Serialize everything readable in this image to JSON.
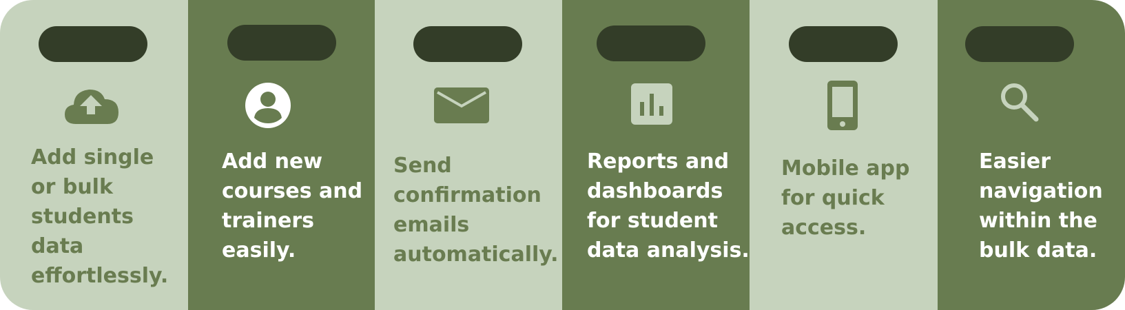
{
  "theme": {
    "light_panel": "#c6d3bd",
    "dark_panel": "#687c50",
    "pill": "#333d28",
    "light_text": "#697c50",
    "dark_text": "#ffffff"
  },
  "features": [
    {
      "icon": "cloud-upload-icon",
      "lines": [
        "Add single",
        "or bulk",
        "students",
        "data",
        "effortlessly."
      ]
    },
    {
      "icon": "user-icon",
      "lines": [
        "Add new",
        "courses and",
        "trainers",
        "easily."
      ]
    },
    {
      "icon": "envelope-icon",
      "lines": [
        "Send",
        "confirmation",
        "emails",
        "automatically."
      ]
    },
    {
      "icon": "bar-chart-icon",
      "lines": [
        "Reports and",
        "dashboards",
        "for student",
        "data analysis."
      ]
    },
    {
      "icon": "smartphone-icon",
      "lines": [
        "Mobile app",
        "for quick",
        "access."
      ]
    },
    {
      "icon": "search-icon",
      "lines": [
        "Easier",
        "navigation",
        "within the",
        "bulk data."
      ]
    }
  ]
}
